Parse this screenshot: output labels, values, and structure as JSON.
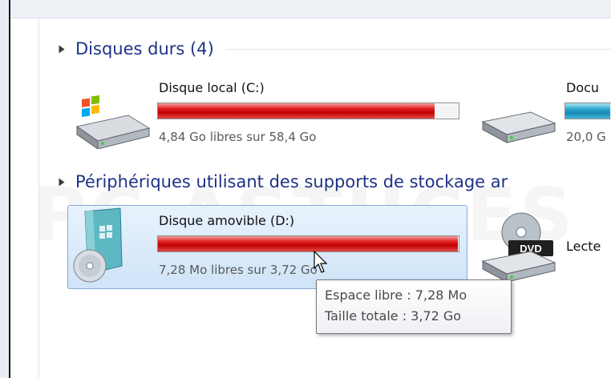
{
  "groups": [
    {
      "title": "Disques durs (4)"
    },
    {
      "title": "Périphériques utilisant des supports de stockage ar"
    }
  ],
  "drives": {
    "c": {
      "label": "Disque local (C:)",
      "sub": "4,84 Go libres sur 58,4 Go",
      "used_fraction": 0.92
    },
    "docs": {
      "label": "Docu",
      "sub": "20,0 G",
      "used_fraction": 0.7
    },
    "d": {
      "label": "Disque amovible (D:)",
      "sub": "7,28 Mo libres sur 3,72 Go",
      "used_fraction": 0.998
    },
    "dvd": {
      "label": "Lecte",
      "badge": "DVD"
    }
  },
  "tooltip": {
    "line1": "Espace libre : 7,28 Mo",
    "line2": "Taille totale : 3,72 Go"
  },
  "watermark": "PC ASTUCES",
  "colors": {
    "group_title": "#1e3287",
    "usage_red": "#d40000",
    "usage_blue": "#1f9cc9",
    "selection_bg": "#d6e8fa"
  }
}
